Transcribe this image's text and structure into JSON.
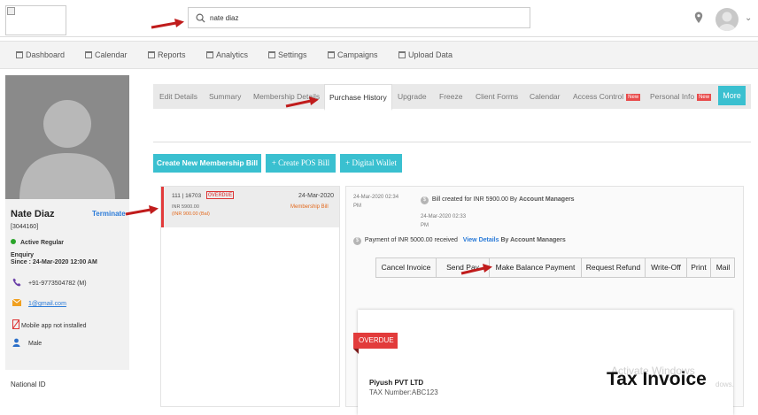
{
  "search": {
    "value": "nate diaz"
  },
  "nav": [
    "Dashboard",
    "Calendar",
    "Reports",
    "Analytics",
    "Settings",
    "Campaigns",
    "Upload Data"
  ],
  "profile": {
    "name": "Nate Diaz",
    "terminate": "Terminate",
    "id": "[3044160]",
    "status": "Active Regular",
    "enquiry": "Enquiry",
    "since_label": "Since : ",
    "since_value": "24-Mar-2020 12:00 AM",
    "phone": "+91-9773504782 (M)",
    "email": "1@gmail.com",
    "app": "Mobile app not installed",
    "gender": "Male",
    "national": "National ID"
  },
  "tabs": [
    "Edit Details",
    "Summary",
    "Membership Details",
    "Purchase History",
    "Upgrade",
    "Freeze",
    "Client Forms",
    "Calendar",
    "Access Control",
    "Personal Info",
    "More"
  ],
  "badge_new": "New",
  "actions": {
    "create_bill": "Create New Membership Bill",
    "create_pos": "+ Create POS Bill",
    "digital_wallet": "+ Digital Wallet"
  },
  "bill": {
    "code": "111 | 16703",
    "overdue": "OVERDUE",
    "date": "24-Mar-2020",
    "amount": "INR 5900.00",
    "balance": "(INR 900.00 (Bal)",
    "type": "Membership Bill"
  },
  "history": {
    "t1_date": "24-Mar-2020 02:34",
    "t1_pm": "PM",
    "t1_text": "Bill created for INR 5900.00 By",
    "t1_by": "Account Managers",
    "t2_date": "24-Mar-2020 02:33",
    "t2_pm": "PM",
    "t2_text": "Payment of INR 5000.00 received",
    "t2_link": "View Details",
    "t2_by": "By  Account Managers"
  },
  "buttons": [
    "Cancel Invoice",
    "Send Pay",
    "Make Balance Payment",
    "Request Refund",
    "Write-Off",
    "Print",
    "Mail"
  ],
  "invoice": {
    "ribbon": "OVERDUE",
    "company": "Piyush PVT LTD",
    "tax_number": "TAX Number:ABC123",
    "title": "Tax Invoice",
    "watermark": "Activate Windows",
    "watermark2": "dows."
  },
  "colors": {
    "accent": "#3ac0d0",
    "danger": "#e23b3b",
    "link": "#2b7bd8"
  }
}
